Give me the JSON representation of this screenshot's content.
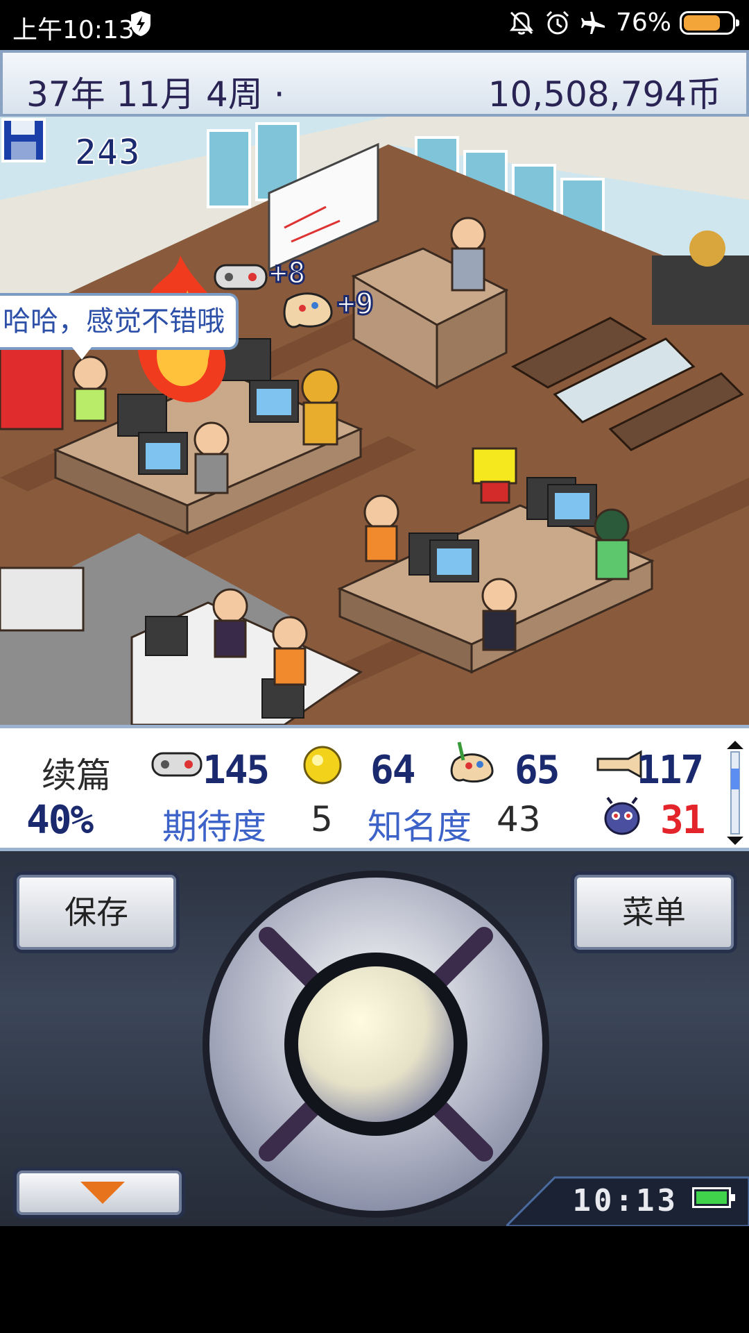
{
  "status_bar": {
    "time": "上午10:13",
    "battery_percent": "76%",
    "battery_level": 0.76,
    "icons": [
      "shield-icon",
      "mute-icon",
      "alarm-icon",
      "airplane-icon",
      "battery-icon"
    ]
  },
  "top_bar": {
    "date": "37年 11月 4周 ·",
    "money": "10,508,794币"
  },
  "scene": {
    "save_count": "243",
    "speech_bubble": "哈哈，感觉不错哦",
    "gains": [
      "+8",
      "+9"
    ]
  },
  "stats": {
    "project_type": "续篇",
    "progress": "40%",
    "fun": "145",
    "creativity": "64",
    "graphics": "65",
    "sound": "117",
    "bugs": "31",
    "anticipation_label": "期待度",
    "anticipation": "5",
    "fame_label": "知名度",
    "fame": "43"
  },
  "controls": {
    "save_label": "保存",
    "menu_label": "菜单",
    "clock": "10:13"
  },
  "colors": {
    "accent_blue": "#3d63c9",
    "bug_red": "#e3242b",
    "battery_orange": "#f3a53a"
  }
}
